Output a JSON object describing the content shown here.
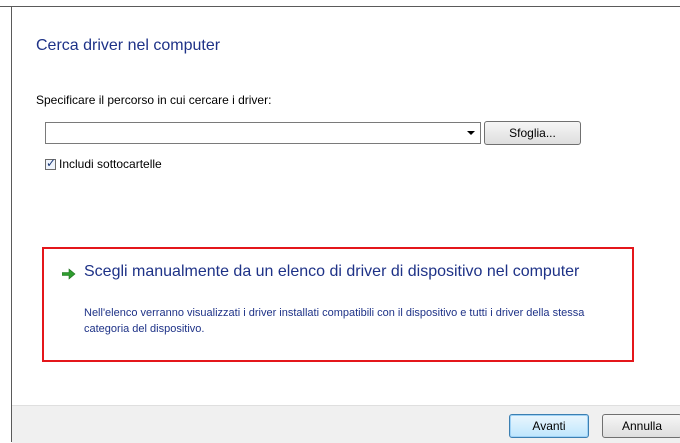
{
  "header": {
    "title": "Cerca driver nel computer"
  },
  "path": {
    "label": "Specificare il percorso in cui cercare i driver:",
    "value": "",
    "browse_label": "Sfoglia..."
  },
  "subfolders": {
    "label": "Includi sottocartelle",
    "checked": true
  },
  "manual_option": {
    "title": "Scegli manualmente da un elenco di driver di dispositivo nel computer",
    "description": "Nell'elenco verranno visualizzati i driver installati compatibili con il dispositivo e tutti i driver della stessa categoria del dispositivo.",
    "highlight_color": "#e4161b",
    "icon": "green-arrow-icon"
  },
  "footer": {
    "next_label": "Avanti",
    "cancel_label": "Annulla"
  }
}
